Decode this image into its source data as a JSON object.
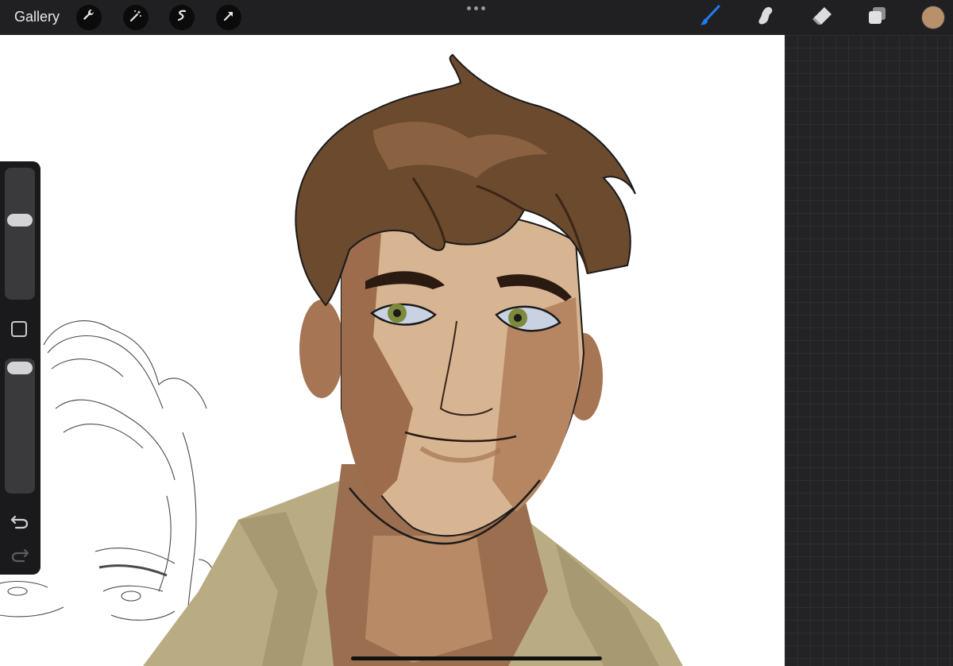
{
  "topbar": {
    "gallery_label": "Gallery",
    "left_tools": [
      "wrench-icon",
      "magic-wand-icon",
      "selection-icon",
      "transform-arrow-icon"
    ],
    "right_tools": [
      "brush-icon",
      "smudge-icon",
      "eraser-icon",
      "layers-icon"
    ],
    "active_tool": "brush-icon",
    "active_tool_color": "#1f7cf5",
    "current_color": "#b8916a"
  },
  "sidebar": {
    "brush_size_level": 0.85,
    "opacity_level": 1.0,
    "buttons": [
      "modify-button-icon",
      "undo-icon",
      "redo-icon"
    ]
  },
  "canvas": {
    "background": "#ffffff",
    "artwork": "illustration-of-man-with-brown-hair",
    "sketch": "pencil-sketch-of-face"
  },
  "colors": {
    "topbar": "#202022",
    "panel": "#232325",
    "skin": "#d8b592",
    "hair": "#6b4a2e",
    "shirt": "#b9ac83"
  }
}
